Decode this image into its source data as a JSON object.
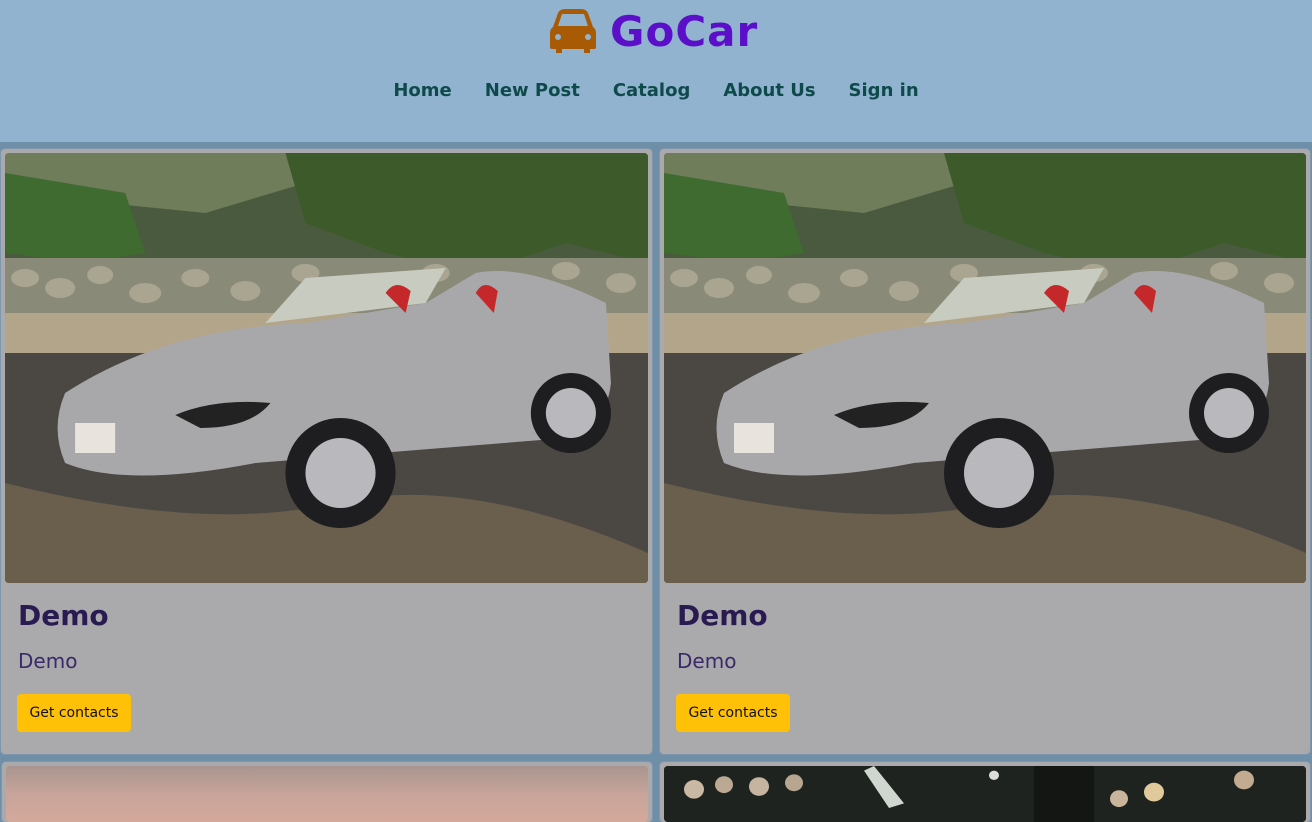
{
  "brand": {
    "name": "GoCar",
    "icon": "car-icon",
    "color": "#5b0fc9",
    "icon_color": "#a85a05"
  },
  "nav": {
    "items": [
      {
        "label": "Home"
      },
      {
        "label": "New Post"
      },
      {
        "label": "Catalog"
      },
      {
        "label": "About Us"
      },
      {
        "label": "Sign in"
      }
    ]
  },
  "cards": [
    {
      "title": "Demo",
      "description": "Demo",
      "button": "Get contacts"
    },
    {
      "title": "Demo",
      "description": "Demo",
      "button": "Get contacts"
    }
  ],
  "colors": {
    "header_bg": "#91b3d0",
    "card_bg": "#aaa9ac",
    "button_bg": "#ffc107",
    "nav_text": "#0f4a4a"
  }
}
